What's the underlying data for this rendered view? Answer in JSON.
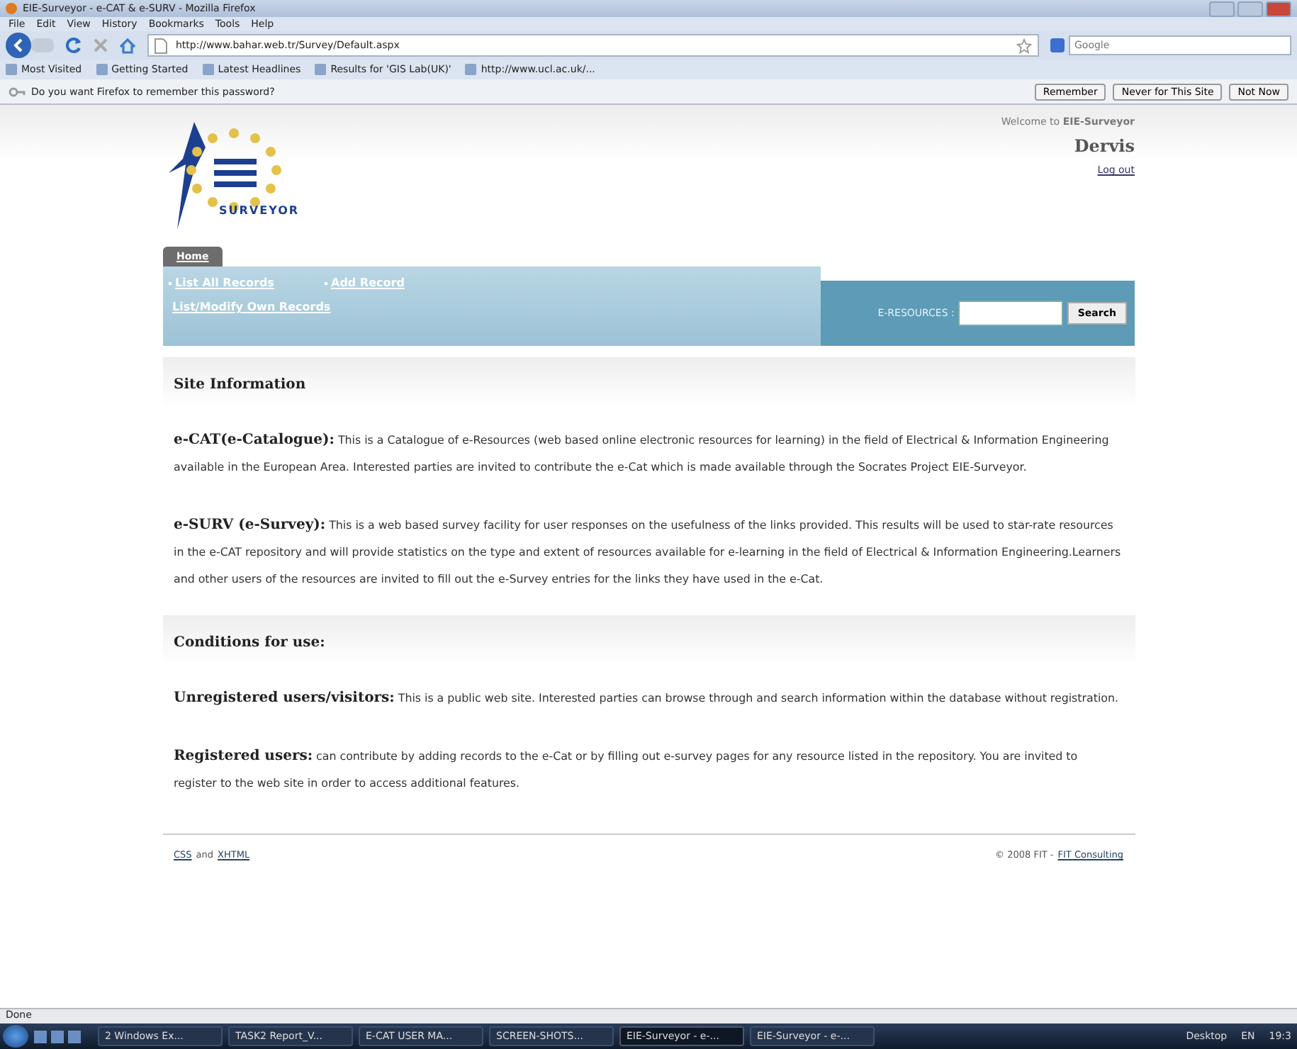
{
  "window": {
    "title": "EIE-Surveyor - e-CAT & e-SURV - Mozilla Firefox"
  },
  "menu": [
    "File",
    "Edit",
    "View",
    "History",
    "Bookmarks",
    "Tools",
    "Help"
  ],
  "address": {
    "value": "http://www.bahar.web.tr/Survey/Default.aspx"
  },
  "web_search": {
    "placeholder": "Google"
  },
  "bookmarks": [
    "Most Visited",
    "Getting Started",
    "Latest Headlines",
    "Results for 'GIS Lab(UK)'",
    "http://www.ucl.ac.uk/..."
  ],
  "password_bar": {
    "message": "Do you want Firefox to remember this password?",
    "buttons": [
      "Remember",
      "Never for This Site",
      "Not Now"
    ]
  },
  "user_panel": {
    "welcome": "Welcome to **EIE-Surveyor**",
    "name": "Dervis",
    "logout": "Log out"
  },
  "logo": {
    "text": "SURVEYOR"
  },
  "tabs": [
    {
      "label": "Home",
      "selected": true
    }
  ],
  "nav_links": [
    "List All Records",
    "Add Record",
    "List/Modify Own Records"
  ],
  "resource_search": {
    "label": "E-RESOURCES :",
    "button": "Search"
  },
  "sections": [
    {
      "heading": "Site Information",
      "paragraphs": [
        "**e-CAT(e-Catalogue):** This is a Catalogue of e-Resources (web based online electronic resources for learning) in the field of Electrical & Information Engineering available in the European Area. Interested parties are invited to contribute the e-Cat which is made available through the Socrates Project EIE-Surveyor.",
        "**e-SURV (e-Survey):** This is a web based survey facility for user responses on the usefulness of the links provided. This results will be used to star-rate resources in the e-CAT repository and will provide statistics on the type and extent of resources available for e-learning in the field of Electrical & Information Engineering.Learners and other users of the resources are invited to fill out the e-Survey entries for the links  they have used in the e-Cat."
      ]
    },
    {
      "heading": "Conditions for use:",
      "paragraphs": [
        "**Unregistered users/visitors:** This is a public web site. Interested parties can browse through and search information within the database without registration.",
        "**Registered users:** can contribute by adding records to the e-Cat or by filling out e-survey pages for any resource listed in the repository. You are invited to register to the web site in order to access additional features."
      ]
    }
  ],
  "footer": {
    "links": [
      "CSS",
      "XHTML"
    ],
    "joiner": "and",
    "copyright": "© 2008 FIT -",
    "company_link": "FIT Consulting"
  },
  "status_bar": {
    "text": "Done"
  },
  "taskbar": {
    "items": [
      {
        "label": "2 Windows Ex...",
        "selected": false
      },
      {
        "label": "TASK2 Report_V...",
        "selected": false
      },
      {
        "label": "E-CAT USER MA...",
        "selected": false
      },
      {
        "label": "SCREEN-SHOTS...",
        "selected": false
      },
      {
        "label": "EIE-Surveyor - e-...",
        "selected": true
      },
      {
        "label": "EIE-Surveyor - e-...",
        "selected": false
      }
    ],
    "desktop": "Desktop",
    "language": "EN",
    "clock": "19:3"
  }
}
